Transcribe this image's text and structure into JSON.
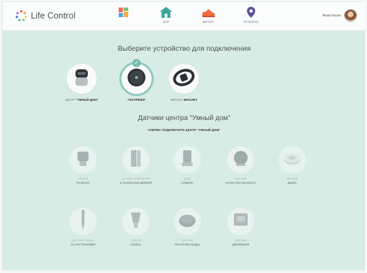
{
  "header": {
    "logo_text": "Life Control",
    "nav": [
      {
        "label": "",
        "icon": "dashboard-grid-icon"
      },
      {
        "label": "дом",
        "icon": "house-icon"
      },
      {
        "label": "фитнес",
        "icon": "sneaker-icon"
      },
      {
        "label": "геотрекер",
        "icon": "location-pin-icon"
      }
    ],
    "user_name": "Анастасия"
  },
  "select_title": "Выберите устройство для подключения",
  "devices": [
    {
      "prefix": "ЦЕНТР",
      "label": "\"УМНЫЙ ДОМ\"",
      "icon": "smart-home-hub-icon",
      "selected": false
    },
    {
      "prefix": "",
      "label": "ГЕОТРЕКЕР",
      "icon": "geotracker-icon",
      "selected": true
    },
    {
      "prefix": "ФИТНЕС",
      "label": "БРАСЛЕТ",
      "icon": "fitness-band-icon",
      "selected": false
    }
  ],
  "sensors_title": "Датчики центра \"Умный дом\"",
  "sensors_note": "СПЕРВА ПОДКЛЮЧИТЕ ЦЕНТР \"УМНЫЙ ДОМ\"",
  "sensors": [
    {
      "prefix": "УМНАЯ",
      "label": "РОЗЕТКА",
      "icon": "smart-plug-icon"
    },
    {
      "prefix": "ДАТЧИК ОТКРЫТИЯ",
      "label": "И ЗАКРЫТИЯ ДВЕРЕЙ",
      "icon": "door-sensor-icon"
    },
    {
      "prefix": "ДОМ",
      "label": "КАМЕРА",
      "icon": "camera-icon"
    },
    {
      "prefix": "ДАТЧИК",
      "label": "КАЧЕСТВА ВОЗДУХА",
      "icon": "air-quality-sensor-icon"
    },
    {
      "prefix": "ДАТЧИК",
      "label": "ДЫМА",
      "icon": "smoke-sensor-icon"
    },
    {
      "prefix": "ДАТЧИК УХОДА",
      "label": "ЗА РАСТЕНИЯМИ",
      "icon": "plant-care-sensor-icon"
    },
    {
      "prefix": "УМНАЯ",
      "label": "ЛАМПА",
      "icon": "smart-lamp-icon"
    },
    {
      "prefix": "ДАТЧИК",
      "label": "ПРОТЕЧКИ ВОДЫ",
      "icon": "water-leak-sensor-icon"
    },
    {
      "prefix": "ДАТЧИК",
      "label": "ДВИЖЕНИЯ",
      "icon": "motion-sensor-icon"
    }
  ],
  "colors": {
    "accent": "#5cb7a8",
    "background": "#d8ece6"
  }
}
